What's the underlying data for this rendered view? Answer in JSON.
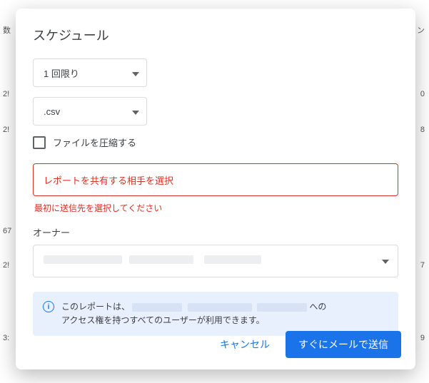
{
  "dialog": {
    "title": "スケジュール",
    "frequency": {
      "value": "1 回限り"
    },
    "format": {
      "value": ".csv"
    },
    "compress": {
      "label": "ファイルを圧縮する",
      "checked": false
    },
    "share": {
      "placeholder": "レポートを共有する相手を選択",
      "error": "最初に送信先を選択してください"
    },
    "owner": {
      "label": "オーナー"
    },
    "info": {
      "prefix": "このレポートは、",
      "suffix1": " への",
      "line2": "アクセス権を持つすべてのユーザーが利用できます。"
    },
    "actions": {
      "cancel": "キャンセル",
      "send": "すぐにメールで送信"
    }
  },
  "bg": {
    "topright": "ン",
    "r1": "数",
    "r2": "2!",
    "r3": "2!",
    "r4": "67",
    "r5": "2!",
    "r6": "3:",
    "rr1": "0",
    "rr2": "8",
    "rr3": "7",
    "rr4": "9"
  }
}
